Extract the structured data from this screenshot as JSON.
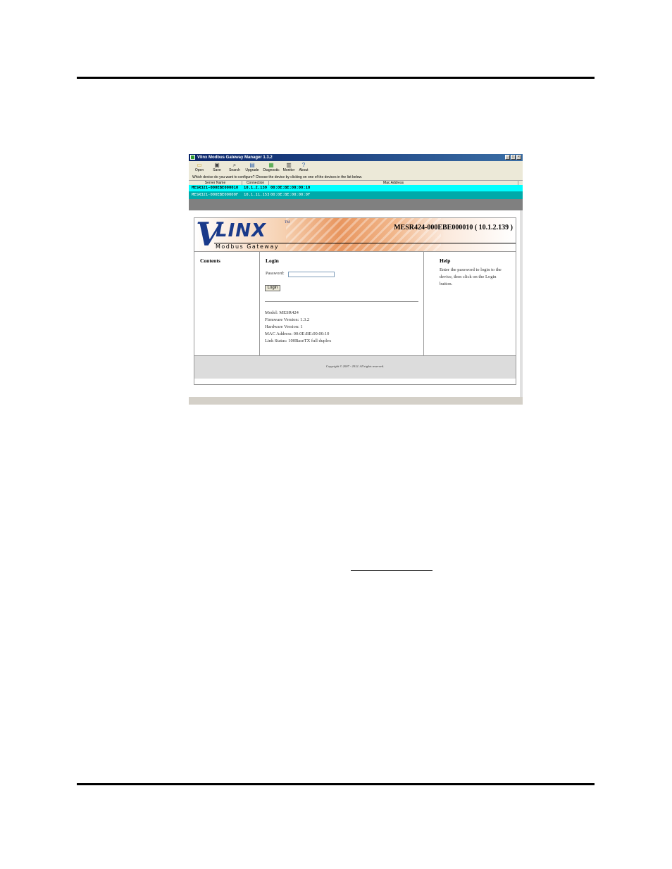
{
  "window": {
    "title": "Vlinx Modbus Gateway Manager 1.3.2",
    "controls": [
      "_",
      "□",
      "×"
    ]
  },
  "toolbar": {
    "items": [
      {
        "label": "Open",
        "icon": "folder-icon",
        "glyph": "▭"
      },
      {
        "label": "Save",
        "icon": "disk-icon",
        "glyph": "▣"
      },
      {
        "label": "Search",
        "icon": "search-icon",
        "glyph": "⌕"
      },
      {
        "label": "Upgrade",
        "icon": "upgrade-icon",
        "glyph": "▤"
      },
      {
        "label": "Diagnostic",
        "icon": "diagnostic-icon",
        "glyph": "▦"
      },
      {
        "label": "Monitor",
        "icon": "monitor-icon",
        "glyph": "▥"
      },
      {
        "label": "About",
        "icon": "help-icon",
        "glyph": "?"
      }
    ]
  },
  "prompt": "Which device do you want to configure? Choose the device by clicking on one of the devices in the list below.",
  "device_list": {
    "columns": [
      "Server Name",
      "Connection",
      "Mac Address"
    ],
    "rows": [
      {
        "name": "MESR321-000EBE000010",
        "connection": "10.1.2.139",
        "mac": "00:0E:BE:00:00:10"
      },
      {
        "name": "MESR321-000EBE00000F",
        "connection": "10.1.11.153",
        "mac": "00:0E:BE:00:00:0F"
      }
    ]
  },
  "web": {
    "logo": {
      "v": "V",
      "linx": "LINX",
      "tm": "TM",
      "sub": "Modbus Gateway"
    },
    "device_title": "MESR424-000EBE000010 ( 10.1.2.139 )",
    "contents_heading": "Contents",
    "login_heading": "Login",
    "password_label": "Password:",
    "password_value": "",
    "login_button": "Login",
    "info": [
      "Model: MESR424",
      "Firmware Version: 1.3.2",
      "Hardware Version: 1",
      "MAC Address: 00:0E:BE:00:00:10",
      "Link Status: 100BaseTX full duplex"
    ],
    "help_heading": "Help",
    "help_text": [
      "Enter the password to login to the",
      "device, then click on the Login",
      "button."
    ],
    "copyright": "Copyright © 2007 - 2012. All rights reserved."
  }
}
